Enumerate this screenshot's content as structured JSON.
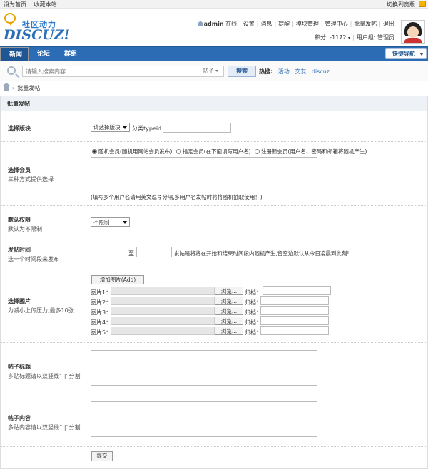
{
  "topbar": {
    "set_home": "设为首页",
    "bookmark": "收藏本站",
    "switch_style": "切换到宽版"
  },
  "header": {
    "logo_cn": "社区动力",
    "logo_en": "DISCUZ!",
    "username": "admin",
    "status": "在线",
    "links": [
      "设置",
      "消息",
      "提醒",
      "模块管理",
      "管理中心",
      "批量发帖",
      "退出"
    ],
    "points": "积分: -1172",
    "group": "用户组: 管理员"
  },
  "nav": {
    "items": [
      "新闻",
      "论坛",
      "群组"
    ],
    "quick_nav": "快捷导航"
  },
  "search": {
    "placeholder": "请输入搜索内容",
    "type": "帖子",
    "button": "搜索",
    "hot_label": "热搜:",
    "hot_keywords": [
      "活动",
      "交友",
      "discuz"
    ]
  },
  "breadcrumb": {
    "current": "批量发帖"
  },
  "form": {
    "title": "批量发帖",
    "block": {
      "label": "选择版块",
      "select_value": "请选择版块",
      "typeid_label": "分类typeid:"
    },
    "member": {
      "label": "选择会员",
      "sub": "三种方式提供选择",
      "options": [
        "随机会员(随机用网站会员发布)",
        "指定会员(在下面填写用户名)",
        "注册新会员(用户名、密码和邮箱将随机产生)"
      ],
      "hint": "(填写多个用户名请用英文逗号分隔,多用户名发帖时将将随机抽取使用！)"
    },
    "permission": {
      "label": "默认权限",
      "sub": "默认为不限制",
      "select_value": "不限制"
    },
    "time": {
      "label": "发帖时间",
      "sub": "选一个时间段来发布",
      "to": "至",
      "hint": "发帖是将将在开始和结束时间段内随机产生,留空边默认从今日凌晨到此刻!"
    },
    "images": {
      "label": "选择图片",
      "sub": "为减小上传压力,最多10张",
      "add_button": "增加图片(Add)",
      "items": [
        {
          "label": "图片1：",
          "browse": "浏览...",
          "archive": "归档："
        },
        {
          "label": "图片2：",
          "browse": "浏览...",
          "archive": "归档："
        },
        {
          "label": "图片3：",
          "browse": "浏览...",
          "archive": "归档："
        },
        {
          "label": "图片4：",
          "browse": "浏览...",
          "archive": "归档："
        },
        {
          "label": "图片5：",
          "browse": "浏览...",
          "archive": "归档："
        }
      ]
    },
    "subject": {
      "label": "帖子标题",
      "sub": "多贴标题请以双竖线“||”分割"
    },
    "content": {
      "label": "帖子内容",
      "sub": "多贴内容请以双竖线“||”分割"
    },
    "submit": "提交"
  }
}
